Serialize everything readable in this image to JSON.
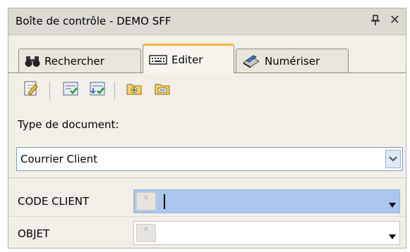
{
  "window": {
    "title": "Boîte de contrôle - DEMO SFF"
  },
  "tabs": [
    {
      "label": "Rechercher",
      "icon": "binoculars-icon",
      "active": false
    },
    {
      "label": "Editer",
      "icon": "keyboard-icon",
      "active": true
    },
    {
      "label": "Numériser",
      "icon": "scanner-icon",
      "active": false
    }
  ],
  "toolbar": {
    "buttons": [
      "edit-document-icon",
      "validate-icon",
      "validate-next-icon",
      "new-folder-icon",
      "open-folder-icon"
    ]
  },
  "document_type": {
    "label": "Type de document:",
    "value": "Courrier Client"
  },
  "fields": [
    {
      "label": "CODE CLIENT",
      "value": "",
      "active": true
    },
    {
      "label": "OBJET",
      "value": "",
      "active": false
    }
  ],
  "field_marker": "x",
  "colors": {
    "accent_tab": "#f2b43f",
    "active_field": "#a9c6ee",
    "panel_bg": "#f1efe7"
  }
}
